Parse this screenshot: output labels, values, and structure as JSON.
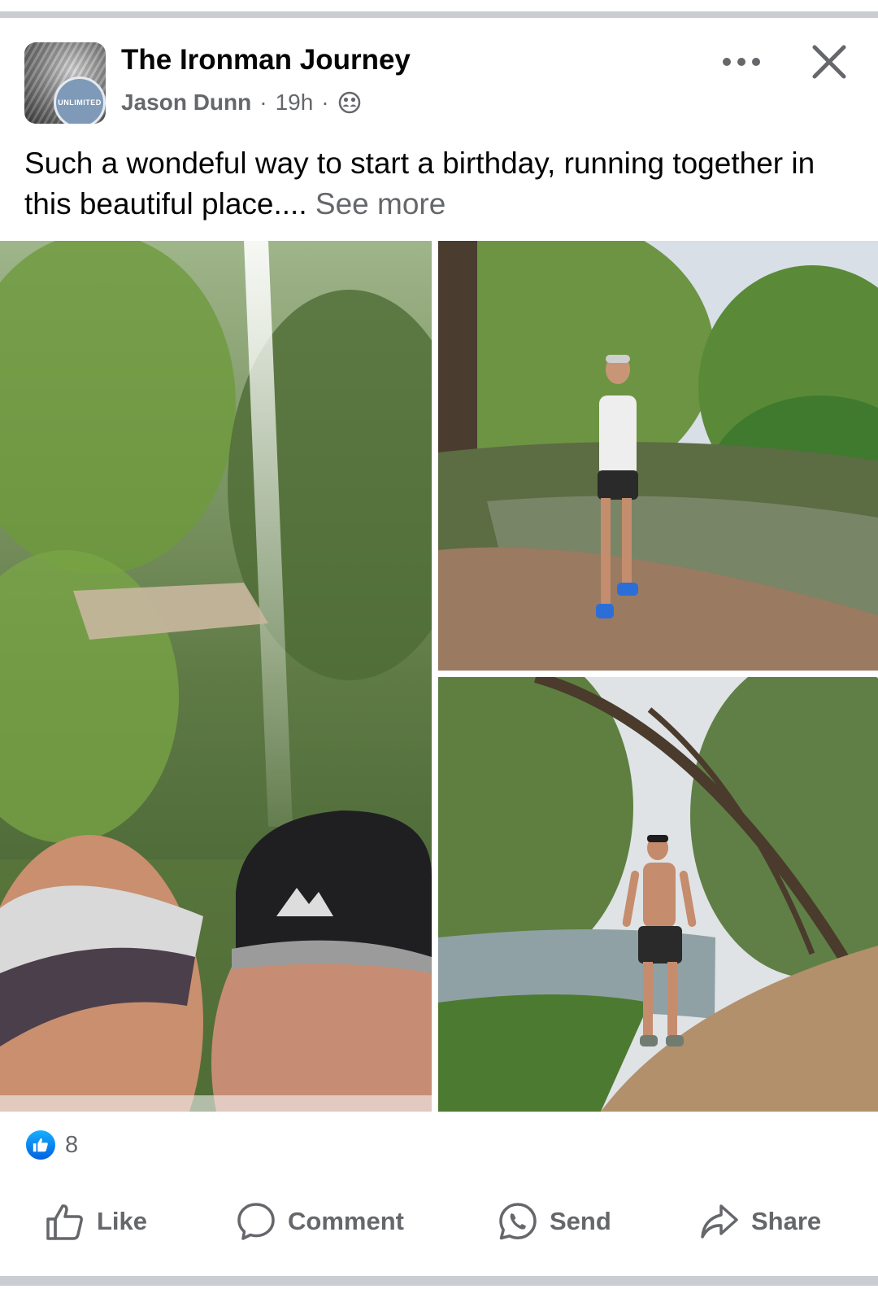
{
  "post": {
    "page_name": "The Ironman Journey",
    "author": "Jason Dunn",
    "separator": "·",
    "time": "19h",
    "privacy_icon": "friends-icon",
    "avatar_badge_text": "UNLIMITED",
    "caption": "Such a wondeful way to start a birthday, running together in this beautiful place....",
    "see_more": "See more"
  },
  "header_actions": {
    "more_icon": "more-options-icon",
    "close_icon": "close-icon"
  },
  "photos": [
    {
      "name": "photo-selfie-couple"
    },
    {
      "name": "photo-woman-by-river"
    },
    {
      "name": "photo-man-by-river"
    }
  ],
  "reactions": {
    "icon": "like-reaction-icon",
    "count": "8"
  },
  "actions": {
    "like": "Like",
    "comment": "Comment",
    "send": "Send",
    "share": "Share"
  },
  "colors": {
    "text_primary": "#050505",
    "text_secondary": "#65676b",
    "like_blue": "#0866ff",
    "divider": "#c9ccd1"
  }
}
